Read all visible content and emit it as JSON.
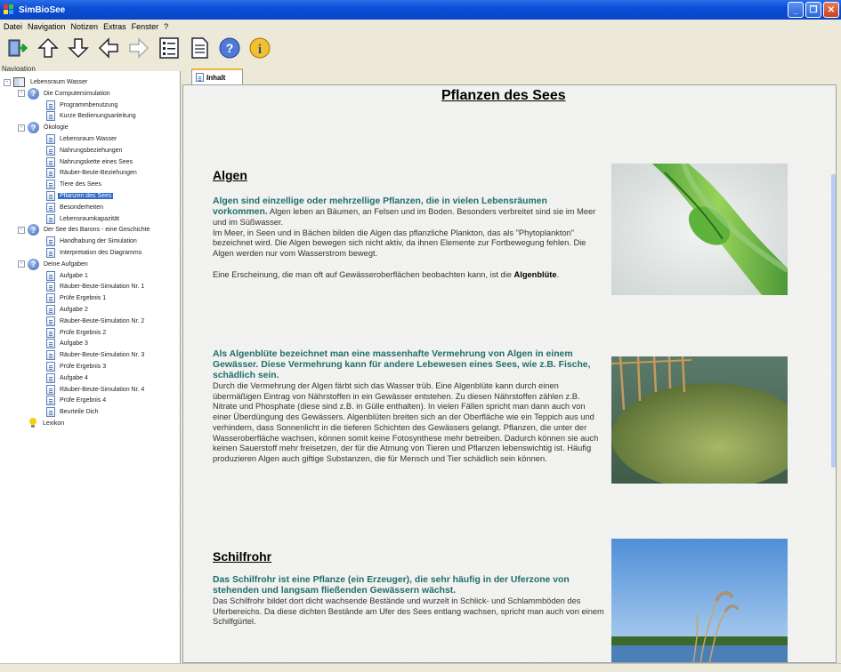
{
  "window": {
    "title": "SimBioSee"
  },
  "menu": [
    "Datei",
    "Navigation",
    "Notizen",
    "Extras",
    "Fenster",
    "?"
  ],
  "toolbar": {
    "icons": [
      "exit-icon",
      "arrow-up-icon",
      "arrow-down-icon",
      "arrow-left-icon",
      "arrow-right-icon",
      "tree-view-icon",
      "document-icon",
      "help-icon",
      "info-icon"
    ]
  },
  "nav": {
    "label": "Navigation",
    "tree": [
      {
        "label": "Lebensraum Wasser",
        "level": 0,
        "icon": "book",
        "expander": "-"
      },
      {
        "label": "Die Computersimulation",
        "level": 1,
        "icon": "help",
        "expander": "-"
      },
      {
        "label": "Programmbenutzung",
        "level": 2,
        "icon": "doc"
      },
      {
        "label": "Kurze Bedienungsanleitung",
        "level": 2,
        "icon": "doc"
      },
      {
        "label": "Ökologie",
        "level": 1,
        "icon": "help",
        "expander": "-"
      },
      {
        "label": "Lebensraum Wasser",
        "level": 2,
        "icon": "doc"
      },
      {
        "label": "Nahrungsbeziehungen",
        "level": 2,
        "icon": "doc"
      },
      {
        "label": "Nahrungskette eines Sees",
        "level": 2,
        "icon": "doc"
      },
      {
        "label": "Räuber-Beute-Beziehungen",
        "level": 2,
        "icon": "doc"
      },
      {
        "label": "Tiere des Sees",
        "level": 2,
        "icon": "doc"
      },
      {
        "label": "Pflanzen des Sees",
        "level": 2,
        "icon": "doc",
        "selected": true
      },
      {
        "label": "Besonderheiten",
        "level": 2,
        "icon": "doc"
      },
      {
        "label": "Lebensraumkapazität",
        "level": 2,
        "icon": "doc"
      },
      {
        "label": "Der See des Barons - eine Geschichte",
        "level": 1,
        "icon": "help",
        "expander": "-"
      },
      {
        "label": "Handhabung der Simulation",
        "level": 2,
        "icon": "doc"
      },
      {
        "label": "Interpretation des Diagramms",
        "level": 2,
        "icon": "doc"
      },
      {
        "label": "Deine Aufgaben",
        "level": 1,
        "icon": "help",
        "expander": "-"
      },
      {
        "label": "Aufgabe 1",
        "level": 2,
        "icon": "doc"
      },
      {
        "label": "Räuber-Beute-Simulation Nr. 1",
        "level": 2,
        "icon": "doc"
      },
      {
        "label": "Prüfe Ergebnis 1",
        "level": 2,
        "icon": "doc"
      },
      {
        "label": "Aufgabe 2",
        "level": 2,
        "icon": "doc"
      },
      {
        "label": "Räuber-Beute-Simulation Nr. 2",
        "level": 2,
        "icon": "doc"
      },
      {
        "label": "Prüfe Ergebnis 2",
        "level": 2,
        "icon": "doc"
      },
      {
        "label": "Aufgabe 3",
        "level": 2,
        "icon": "doc"
      },
      {
        "label": "Räuber-Beute-Simulation Nr. 3",
        "level": 2,
        "icon": "doc"
      },
      {
        "label": "Prüfe Ergebnis 3",
        "level": 2,
        "icon": "doc"
      },
      {
        "label": "Aufgabe 4",
        "level": 2,
        "icon": "doc"
      },
      {
        "label": "Räuber-Beute-Simulation Nr. 4",
        "level": 2,
        "icon": "doc"
      },
      {
        "label": "Prüfe Ergebnis 4",
        "level": 2,
        "icon": "doc"
      },
      {
        "label": "Beurteile Dich",
        "level": 2,
        "icon": "doc"
      },
      {
        "label": "Lexikon",
        "level": 1,
        "icon": "bulb"
      }
    ]
  },
  "tabs": [
    {
      "label": "Inhalt"
    }
  ],
  "content": {
    "title": "Pflanzen des Sees",
    "sections": [
      {
        "heading": "Algen",
        "lead": "Algen sind einzellige oder mehrzellige Pflanzen, die in vielen Lebensräumen vorkommen.",
        "body1": " Algen leben an Bäumen, an Felsen und im Boden. Besonders verbreitet sind sie im Meer und im Süßwasser.",
        "body2": "Im Meer, in Seen und in Bächen bilden die Algen das pflanzliche Plankton, das als \"Phytoplankton\" bezeichnet wird. Die Algen bewegen sich nicht aktiv, da ihnen Elemente zur Fortbewegung fehlen. Die Algen werden nur vom Wasserstrom bewegt.",
        "body3": "Eine Erscheinung, die man oft auf Gewässeroberflächen beobachten kann, ist die ",
        "keyword": "Algenblüte",
        "tail": "."
      },
      {
        "lead": "Als Algenblüte bezeichnet man eine massenhafte Vermehrung von Algen in einem Gewässer. Diese Vermehrung kann für andere Lebewesen eines Sees, wie z.B. Fische, schädlich sein.",
        "body": "Durch die Vermehrung der Algen färbt sich das Wasser trüb. Eine Algenblüte kann durch einen übermäßigen Eintrag von Nährstoffen in ein Gewässer entstehen. Zu diesen Nährstoffen zählen z.B. Nitrate und Phosphate (diese sind z.B. in Gülle enthalten). In vielen Fällen spricht man dann auch von einer Überdüngung des Gewässers. Algenblüten breiten sich an der Oberfläche wie ein Teppich aus und verhindern, dass Sonnenlicht in die tieferen Schichten des Gewässers gelangt. Pflanzen, die unter der Wasseroberfläche wachsen, können somit keine Fotosynthese mehr betreiben. Dadurch können sie auch keinen Sauerstoff mehr freisetzen, der für die Atmung von Tieren und Pflanzen lebenswichtig ist. Häufig produzieren Algen auch giftige Substanzen, die für Mensch und Tier schädlich sein können."
      },
      {
        "heading": "Schilfrohr",
        "lead": "Das Schilfrohr ist eine Pflanze (ein Erzeuger), die sehr häufig in der Uferzone von stehenden und langsam fließenden Gewässern wächst.",
        "body": "Das Schilfrohr bildet dort dicht wachsende Bestände und wurzelt in Schlick- und Schlammböden des Uferbereichs. Da diese dichten Bestände am Ufer des Sees entlang wachsen, spricht man auch von einem Schilfgürtel."
      }
    ]
  }
}
